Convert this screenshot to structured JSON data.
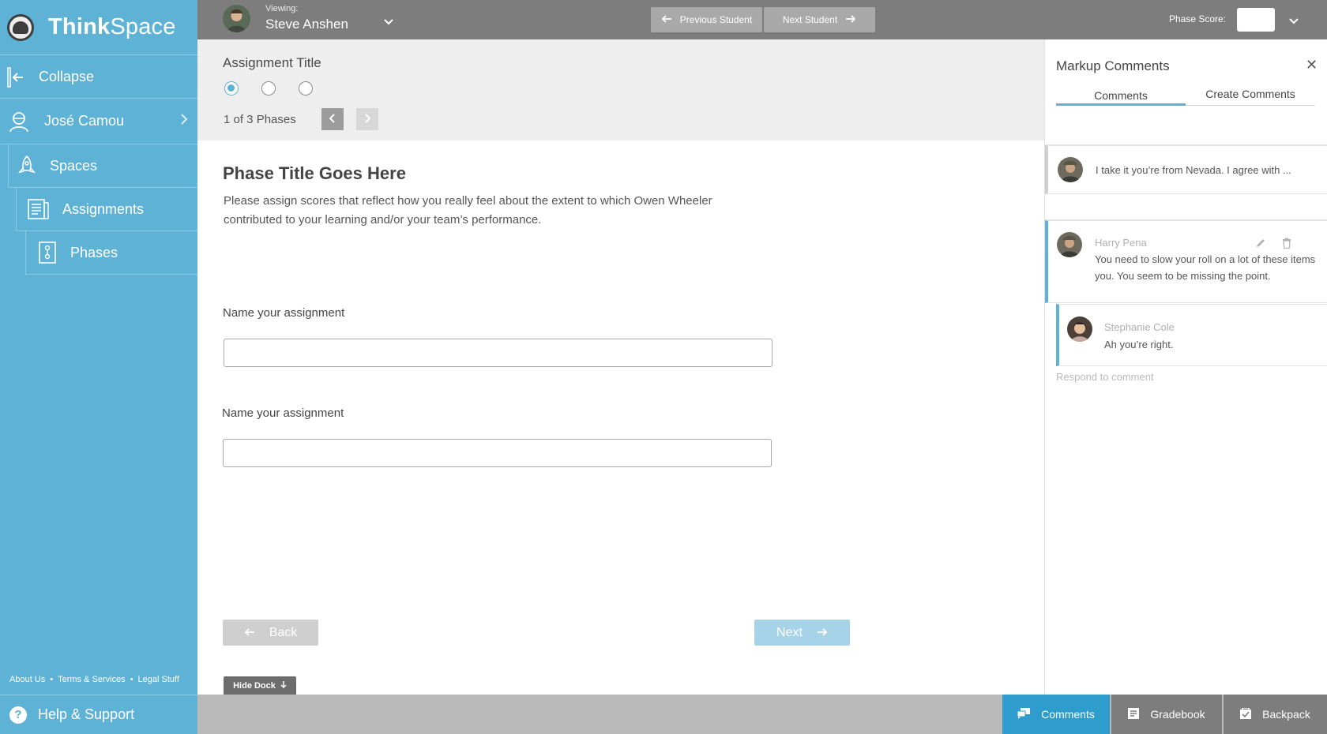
{
  "app": {
    "name_bold": "Think",
    "name_light": "Space"
  },
  "sidebar": {
    "collapse_label": "Collapse",
    "user_name": "José Camou",
    "items": [
      {
        "label": "Spaces"
      },
      {
        "label": "Assignments"
      },
      {
        "label": "Phases"
      }
    ],
    "footer_links": [
      "About Us",
      "Terms & Services",
      "Legal Stuff"
    ],
    "help_label": "Help & Support"
  },
  "topbar": {
    "viewing_label": "Viewing:",
    "student_name": "Steve Anshen",
    "prev_student": "Previous Student",
    "next_student": "Next Student",
    "phase_score_label": "Phase Score:",
    "phase_score_value": ""
  },
  "phase": {
    "assignment_title": "Assignment Title",
    "phase_count": "1 of 3 Phases",
    "title": "Phase Title Goes Here",
    "description": "Please assign scores that reflect how you really feel about the extent to which Owen Wheeler contributed to your learning and/or your team’s performance.",
    "fields": [
      {
        "label": "Name your assignment",
        "value": ""
      },
      {
        "label": "Name your assignment",
        "value": ""
      }
    ],
    "back_label": "Back",
    "next_label": "Next",
    "hide_dock_label": "Hide Dock"
  },
  "comments_panel": {
    "title": "Markup Comments",
    "tabs": [
      {
        "label": "Comments",
        "active": true
      },
      {
        "label": "Create Comments",
        "active": false
      }
    ],
    "collapsed_comment": "I take it you’re from Nevada. I agree with ...",
    "open_comment": {
      "author": "Harry Pena",
      "text_line1": "You need to slow your roll on a lot of these items",
      "text_line2": "you. You seem to be missing the point."
    },
    "reply": {
      "author": "Stephanie Cole",
      "text": "Ah you’re right."
    },
    "respond_placeholder": "Respond to comment"
  },
  "dock": {
    "comments": "Comments",
    "gradebook": "Gradebook",
    "backpack": "Backpack"
  },
  "colors": {
    "sidebar": "#5eb2d6",
    "topbar": "#7d7d7d",
    "accent": "#2e9ccd"
  }
}
